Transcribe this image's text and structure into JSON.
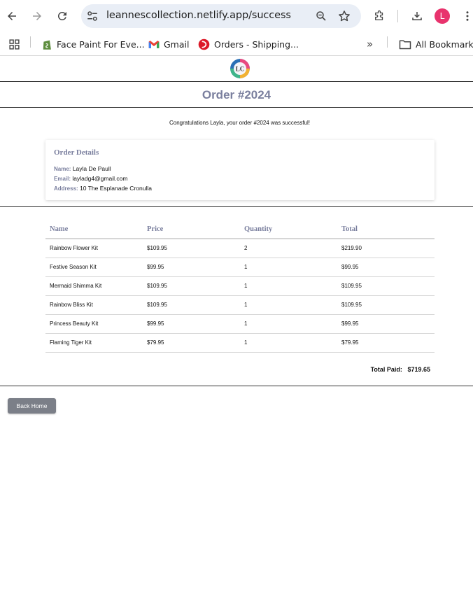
{
  "browser": {
    "url": "leannescollection.netlify.app/success",
    "profile_initial": "L",
    "bookmarks": [
      {
        "label": "Face Paint For Eve...",
        "icon": "shopify-icon"
      },
      {
        "label": "Gmail",
        "icon": "gmail-icon"
      },
      {
        "label": "Orders - Shipping...",
        "icon": "auspost-icon"
      }
    ],
    "all_bookmarks_label": "All Bookmarks",
    "overflow_label": "»"
  },
  "page": {
    "logo_text": "LC",
    "title": "Order #2024",
    "congrats": "Congratulations Layla, your order #2024 was successful!",
    "details": {
      "heading": "Order Details",
      "name_label": "Name:",
      "name_value": "Layla De Paull",
      "email_label": "Email:",
      "email_value": "layladg4@gmail.com",
      "address_label": "Address:",
      "address_value": "10 The Esplanade Cronulla"
    },
    "table": {
      "headers": [
        "Name",
        "Price",
        "Quantity",
        "Total"
      ],
      "rows": [
        [
          "Rainbow Flower Kit",
          "$109.95",
          "2",
          "$219.90"
        ],
        [
          "Festive Season Kit",
          "$99.95",
          "1",
          "$99.95"
        ],
        [
          "Mermaid Shimma Kit",
          "$109.95",
          "1",
          "$109.95"
        ],
        [
          "Rainbow Bliss Kit",
          "$109.95",
          "1",
          "$109.95"
        ],
        [
          "Princess Beauty Kit",
          "$99.95",
          "1",
          "$99.95"
        ],
        [
          "Flaming Tiger Kit",
          "$79.95",
          "1",
          "$79.95"
        ]
      ]
    },
    "total_label": "Total Paid:",
    "total_value": "$719.65",
    "back_button": "Back Home"
  },
  "colors": {
    "accent": "#7a7f9e",
    "button": "#7b7f88",
    "avatar": "#e8336d"
  }
}
